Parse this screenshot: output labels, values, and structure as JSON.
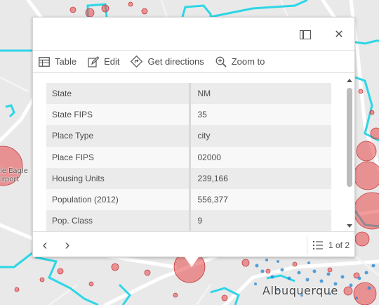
{
  "map": {
    "city_label": "Albuquerque",
    "airport_label": "le Eagle\nirport",
    "colors": {
      "boundary": "#2dd6e6",
      "red_point": "#e8484a",
      "blue_point": "#2a8bd8"
    }
  },
  "popup": {
    "header": {
      "dock_icon": "dock-icon",
      "close_icon": "close-icon",
      "close_glyph": "✕"
    },
    "actions": [
      {
        "label": "Table",
        "icon": "table-icon"
      },
      {
        "label": "Edit",
        "icon": "edit-icon"
      },
      {
        "label": "Get directions",
        "icon": "directions-icon"
      },
      {
        "label": "Zoom to",
        "icon": "zoom-in-icon"
      }
    ],
    "attributes": [
      {
        "key": "State",
        "value": "NM"
      },
      {
        "key": "State FIPS",
        "value": "35"
      },
      {
        "key": "Place Type",
        "value": "city"
      },
      {
        "key": "Place FIPS",
        "value": "02000"
      },
      {
        "key": "Housing Units",
        "value": "239,166"
      },
      {
        "key": "Population (2012)",
        "value": "556,377"
      },
      {
        "key": "Pop. Class",
        "value": "9"
      }
    ],
    "footer": {
      "prev_glyph": "‹",
      "next_glyph": "›",
      "pager_text": "1 of 2",
      "pager_icon": "list-icon"
    }
  }
}
